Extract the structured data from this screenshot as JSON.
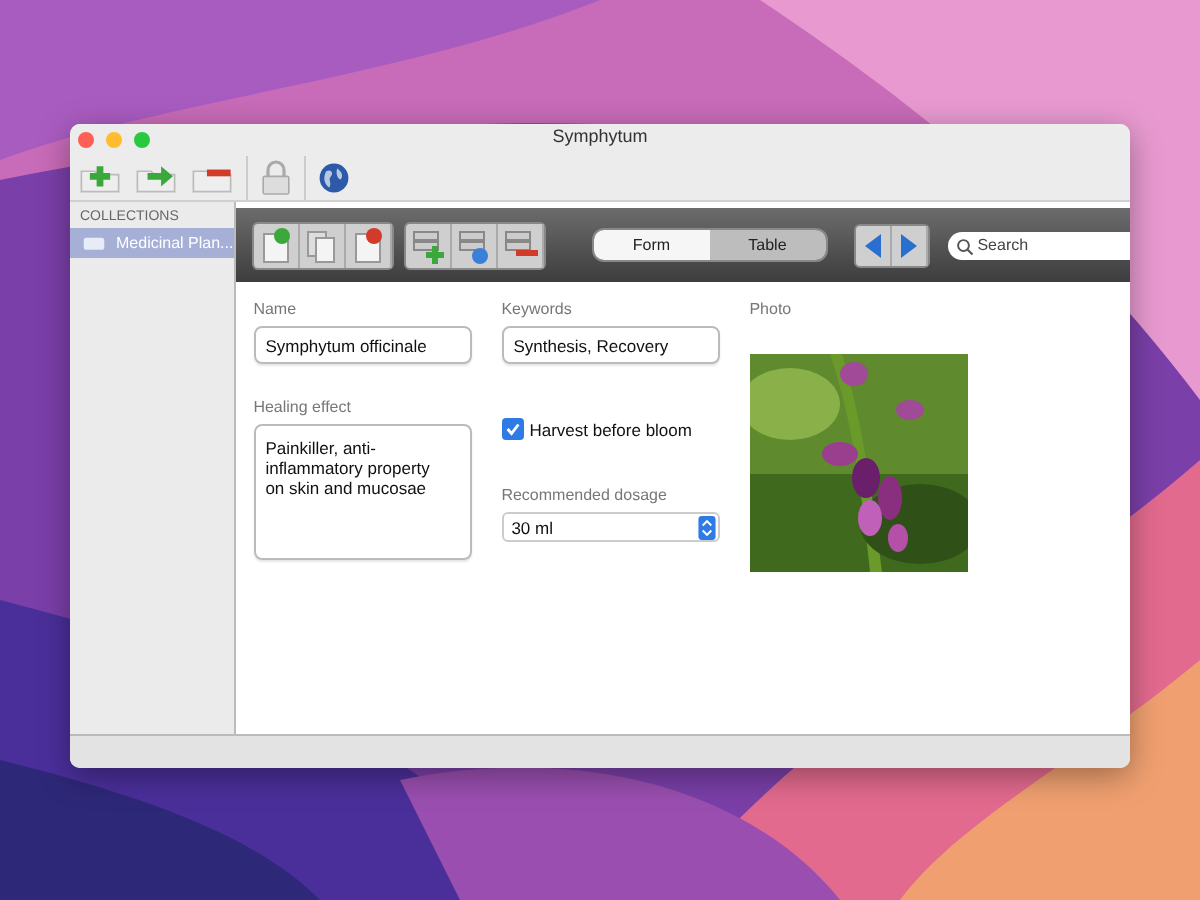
{
  "window": {
    "title": "Symphytum"
  },
  "sidebar": {
    "header": "COLLECTIONS",
    "items": [
      {
        "label": "Medicinal Plan...",
        "selected": true
      }
    ]
  },
  "view_switch": [
    {
      "label": "Form",
      "selected": true
    },
    {
      "label": "Table",
      "selected": false
    }
  ],
  "search": {
    "placeholder": "Search"
  },
  "form": {
    "name": {
      "label": "Name",
      "value": "Symphytum officinale"
    },
    "keywords": {
      "label": "Keywords",
      "value": "Synthesis, Recovery"
    },
    "healing_effect": {
      "label": "Healing effect",
      "value": "Painkiller, anti-inflammatory property on skin and mucosae"
    },
    "harvest": {
      "label": "Harvest before bloom",
      "checked": true
    },
    "dosage": {
      "label": "Recommended dosage",
      "value": "30 ml"
    },
    "photo": {
      "label": "Photo",
      "kind": "picture"
    }
  }
}
